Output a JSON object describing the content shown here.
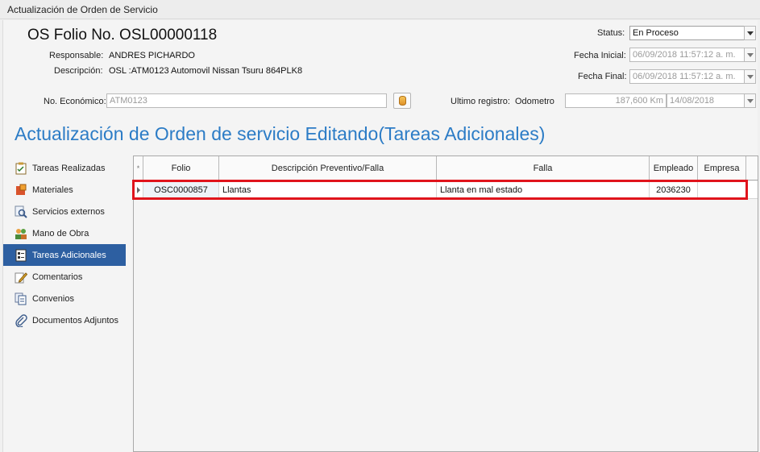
{
  "window": {
    "title": "Actualización de Orden de Servicio"
  },
  "header": {
    "folio_title": "OS Folio No. OSL00000118",
    "responsable_label": "Responsable:",
    "responsable_value": "ANDRES PICHARDO",
    "descripcion_label": "Descripción:",
    "descripcion_value": "OSL :ATM0123 Automovil  Nissan  Tsuru  864PLK8",
    "status_label": "Status:",
    "status_value": "En Proceso",
    "fecha_inicial_label": "Fecha Inicial:",
    "fecha_inicial_value": "06/09/2018 11:57:12 a. m.",
    "fecha_final_label": "Fecha Final:",
    "fecha_final_value": "06/09/2018 11:57:12 a. m.",
    "no_economico_label": "No. Económico:",
    "no_economico_value": "ATM0123",
    "ultimo_registro_label": "Ultimo registro:",
    "odometro_label": "Odometro",
    "odometro_value": "187,600 Km",
    "odometro_date": "14/08/2018"
  },
  "section_title": "Actualización de Orden de servicio Editando(Tareas Adicionales)",
  "sidebar": {
    "items": [
      {
        "label": "Tareas Realizadas",
        "icon": "checklist-icon"
      },
      {
        "label": "Materiales",
        "icon": "materials-icon"
      },
      {
        "label": "Servicios externos",
        "icon": "magnifier-icon"
      },
      {
        "label": "Mano de Obra",
        "icon": "workers-icon"
      },
      {
        "label": "Tareas Adicionales",
        "icon": "tasks-icon",
        "selected": true
      },
      {
        "label": "Comentarios",
        "icon": "pencil-icon"
      },
      {
        "label": "Convenios",
        "icon": "documents-icon"
      },
      {
        "label": "Documentos Adjuntos",
        "icon": "paperclip-icon"
      }
    ]
  },
  "grid": {
    "new_row_marker": "*",
    "columns": [
      "Folio",
      "Descripción Preventivo/Falla",
      "Falla",
      "Empleado",
      "Empresa"
    ],
    "rows": [
      {
        "folio": "OSC0000857",
        "descripcion": "Llantas",
        "falla": "Llanta en mal estado",
        "empleado": "2036230",
        "empresa": ""
      }
    ]
  },
  "colors": {
    "accent": "#2c7cc6",
    "selected_nav": "#2d5fa1",
    "highlight_box": "#e0141c"
  }
}
